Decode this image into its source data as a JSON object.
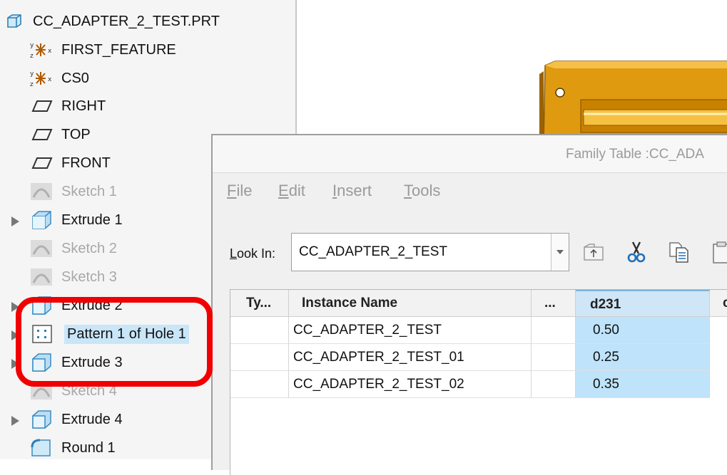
{
  "model_tree": {
    "root": "CC_ADAPTER_2_TEST.PRT",
    "items": [
      {
        "label": "FIRST_FEATURE",
        "icon": "coordinate-system-icon"
      },
      {
        "label": "CS0",
        "icon": "coordinate-system-icon"
      },
      {
        "label": "RIGHT",
        "icon": "datum-plane-icon"
      },
      {
        "label": "TOP",
        "icon": "datum-plane-icon"
      },
      {
        "label": "FRONT",
        "icon": "datum-plane-icon"
      },
      {
        "label": "Sketch 1",
        "icon": "sketch-icon"
      },
      {
        "label": "Extrude 1",
        "icon": "extrude-icon"
      },
      {
        "label": "Sketch 2",
        "icon": "sketch-icon"
      },
      {
        "label": "Sketch 3",
        "icon": "sketch-icon"
      },
      {
        "label": "Extrude 2",
        "icon": "extrude-icon"
      },
      {
        "label": "Pattern 1 of Hole 1",
        "icon": "pattern-icon"
      },
      {
        "label": "Extrude 3",
        "icon": "extrude-icon"
      },
      {
        "label": "Sketch 4",
        "icon": "sketch-icon"
      },
      {
        "label": "Extrude 4",
        "icon": "extrude-icon"
      },
      {
        "label": "Round 1",
        "icon": "round-icon"
      }
    ]
  },
  "family_table": {
    "title": "Family Table :CC_ADA",
    "menu": [
      "File",
      "Edit",
      "Insert",
      "Tools"
    ],
    "look_in_label": "Look In:",
    "look_in_value": "CC_ADAPTER_2_TEST",
    "columns": [
      "Ty...",
      "Instance Name",
      "...",
      "d231",
      "c"
    ],
    "rows": [
      {
        "type": "",
        "name": "CC_ADAPTER_2_TEST",
        "d231": "0.50"
      },
      {
        "type": "",
        "name": "CC_ADAPTER_2_TEST_01",
        "d231": "0.25"
      },
      {
        "type": "",
        "name": "CC_ADAPTER_2_TEST_02",
        "d231": "0.35"
      }
    ]
  },
  "colors": {
    "highlight": "#c9e6f8",
    "selected_column": "#bfe3fa",
    "annotation_box": "#f00000",
    "part_orange": "#e09a10"
  }
}
